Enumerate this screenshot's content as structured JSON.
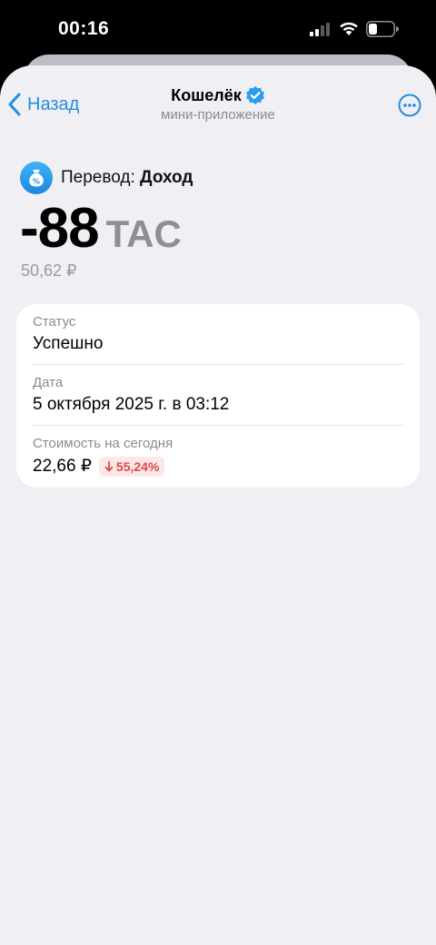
{
  "status_bar": {
    "time": "00:16"
  },
  "nav": {
    "back_label": "Назад",
    "title": "Кошелёк",
    "subtitle": "мини-приложение"
  },
  "transaction": {
    "type_label": "Перевод:",
    "type_value": "Доход",
    "amount": "-88",
    "currency": "TAC",
    "fiat": "50,62 ₽"
  },
  "details": {
    "status_label": "Статус",
    "status_value": "Успешно",
    "date_label": "Дата",
    "date_value": "5 октября 2025 г. в 03:12",
    "value_label": "Стоимость на сегодня",
    "value_value": "22,66 ₽",
    "change": "55,24%"
  },
  "colors": {
    "accent": "#1f8fe0",
    "background": "#efeff4",
    "card": "#ffffff",
    "negative": "#e0484c"
  }
}
